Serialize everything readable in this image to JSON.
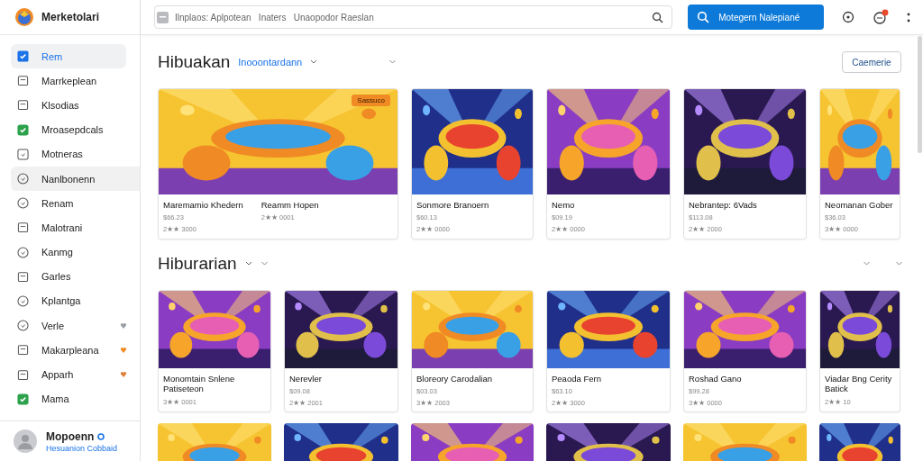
{
  "app": {
    "name": "Merketolari"
  },
  "search": {
    "placeholder": "Ilnplaos: Aplpotean   Inaters   Unaopodor Raeslan"
  },
  "primary_button": {
    "label": "Motegern Nalepiané"
  },
  "notifications": {
    "unread": true
  },
  "sidebar": {
    "items": [
      {
        "label": "Rem",
        "selected": true,
        "hover": false
      },
      {
        "label": "Marrkeplean",
        "selected": false,
        "hover": false
      },
      {
        "label": "Klsodias",
        "selected": false,
        "hover": false
      },
      {
        "label": "Mroasepdcals",
        "selected": false,
        "hover": false
      },
      {
        "label": "Motneras",
        "selected": false,
        "hover": false
      },
      {
        "label": "Nanlbonenn",
        "selected": false,
        "hover": true
      },
      {
        "label": "Renam",
        "selected": false,
        "hover": false
      },
      {
        "label": "Malotrani",
        "selected": false,
        "hover": false
      },
      {
        "label": "Kanmg",
        "selected": false,
        "hover": false
      },
      {
        "label": "Garles",
        "selected": false,
        "hover": false
      },
      {
        "label": "Kplantga",
        "selected": false,
        "hover": false
      },
      {
        "label": "Verle",
        "selected": false,
        "hover": false,
        "color": "#9aa0a6"
      },
      {
        "label": "Makarpleana",
        "selected": false,
        "hover": false,
        "color": "#f08a24"
      },
      {
        "label": "Apparh",
        "selected": false,
        "hover": false,
        "color": "#e0803a"
      },
      {
        "label": "Mama",
        "selected": false,
        "hover": false
      }
    ],
    "user": {
      "name": "Mopoenn",
      "verified": true,
      "link": "Hesuanion Cobbaid"
    }
  },
  "sections": [
    {
      "title": "Hibuakan",
      "link": "Inooontardann",
      "button": "Caemerie",
      "cards": [
        {
          "wide": true,
          "badge": "Sassuco",
          "title": "Maremamio Khedern",
          "price": "$66.23",
          "rating": "2★★ 3000",
          "title_2": "Reamm Hopen",
          "rating_2": "2★★ 0001"
        },
        {
          "title": "Sonmore Branoern",
          "price": "$60.13",
          "rating": "2★★ 0000"
        },
        {
          "title": "Nemo",
          "price": "$09.19",
          "rating": "2★★ 0000"
        },
        {
          "title": "Nebrantep: 6Vads",
          "price": "$113.08",
          "rating": "2★★ 2000"
        },
        {
          "title": "Neomanan Gober",
          "price": "$36.03",
          "rating": "3★★ 0000"
        }
      ]
    },
    {
      "title": "Hiburarian",
      "cards": [
        {
          "title": "Monomtain Snlene Patiseteon",
          "rating": "3★★ 0001"
        },
        {
          "title": "Nerevler",
          "price": "$09.08",
          "rating": "2★★ 2001"
        },
        {
          "title": "Bloreory Carodalian",
          "price": "$03.03",
          "rating": "3★★ 2003"
        },
        {
          "title": "Peaoda Fern",
          "price": "$63.10",
          "rating": "2★★ 3000"
        },
        {
          "title": "Roshad Gano",
          "price": "$99.28",
          "rating": "3★★ 0000"
        },
        {
          "title": "Viadar Bng Cerity Batick",
          "rating": "2★★ 10"
        }
      ]
    },
    {
      "cards": [
        {
          "kind": "picture"
        },
        {
          "kind": "picture"
        },
        {
          "kind": "picture"
        },
        {
          "kind": "picture"
        },
        {
          "kind": "picture"
        },
        {
          "kind": "picture"
        }
      ]
    }
  ]
}
